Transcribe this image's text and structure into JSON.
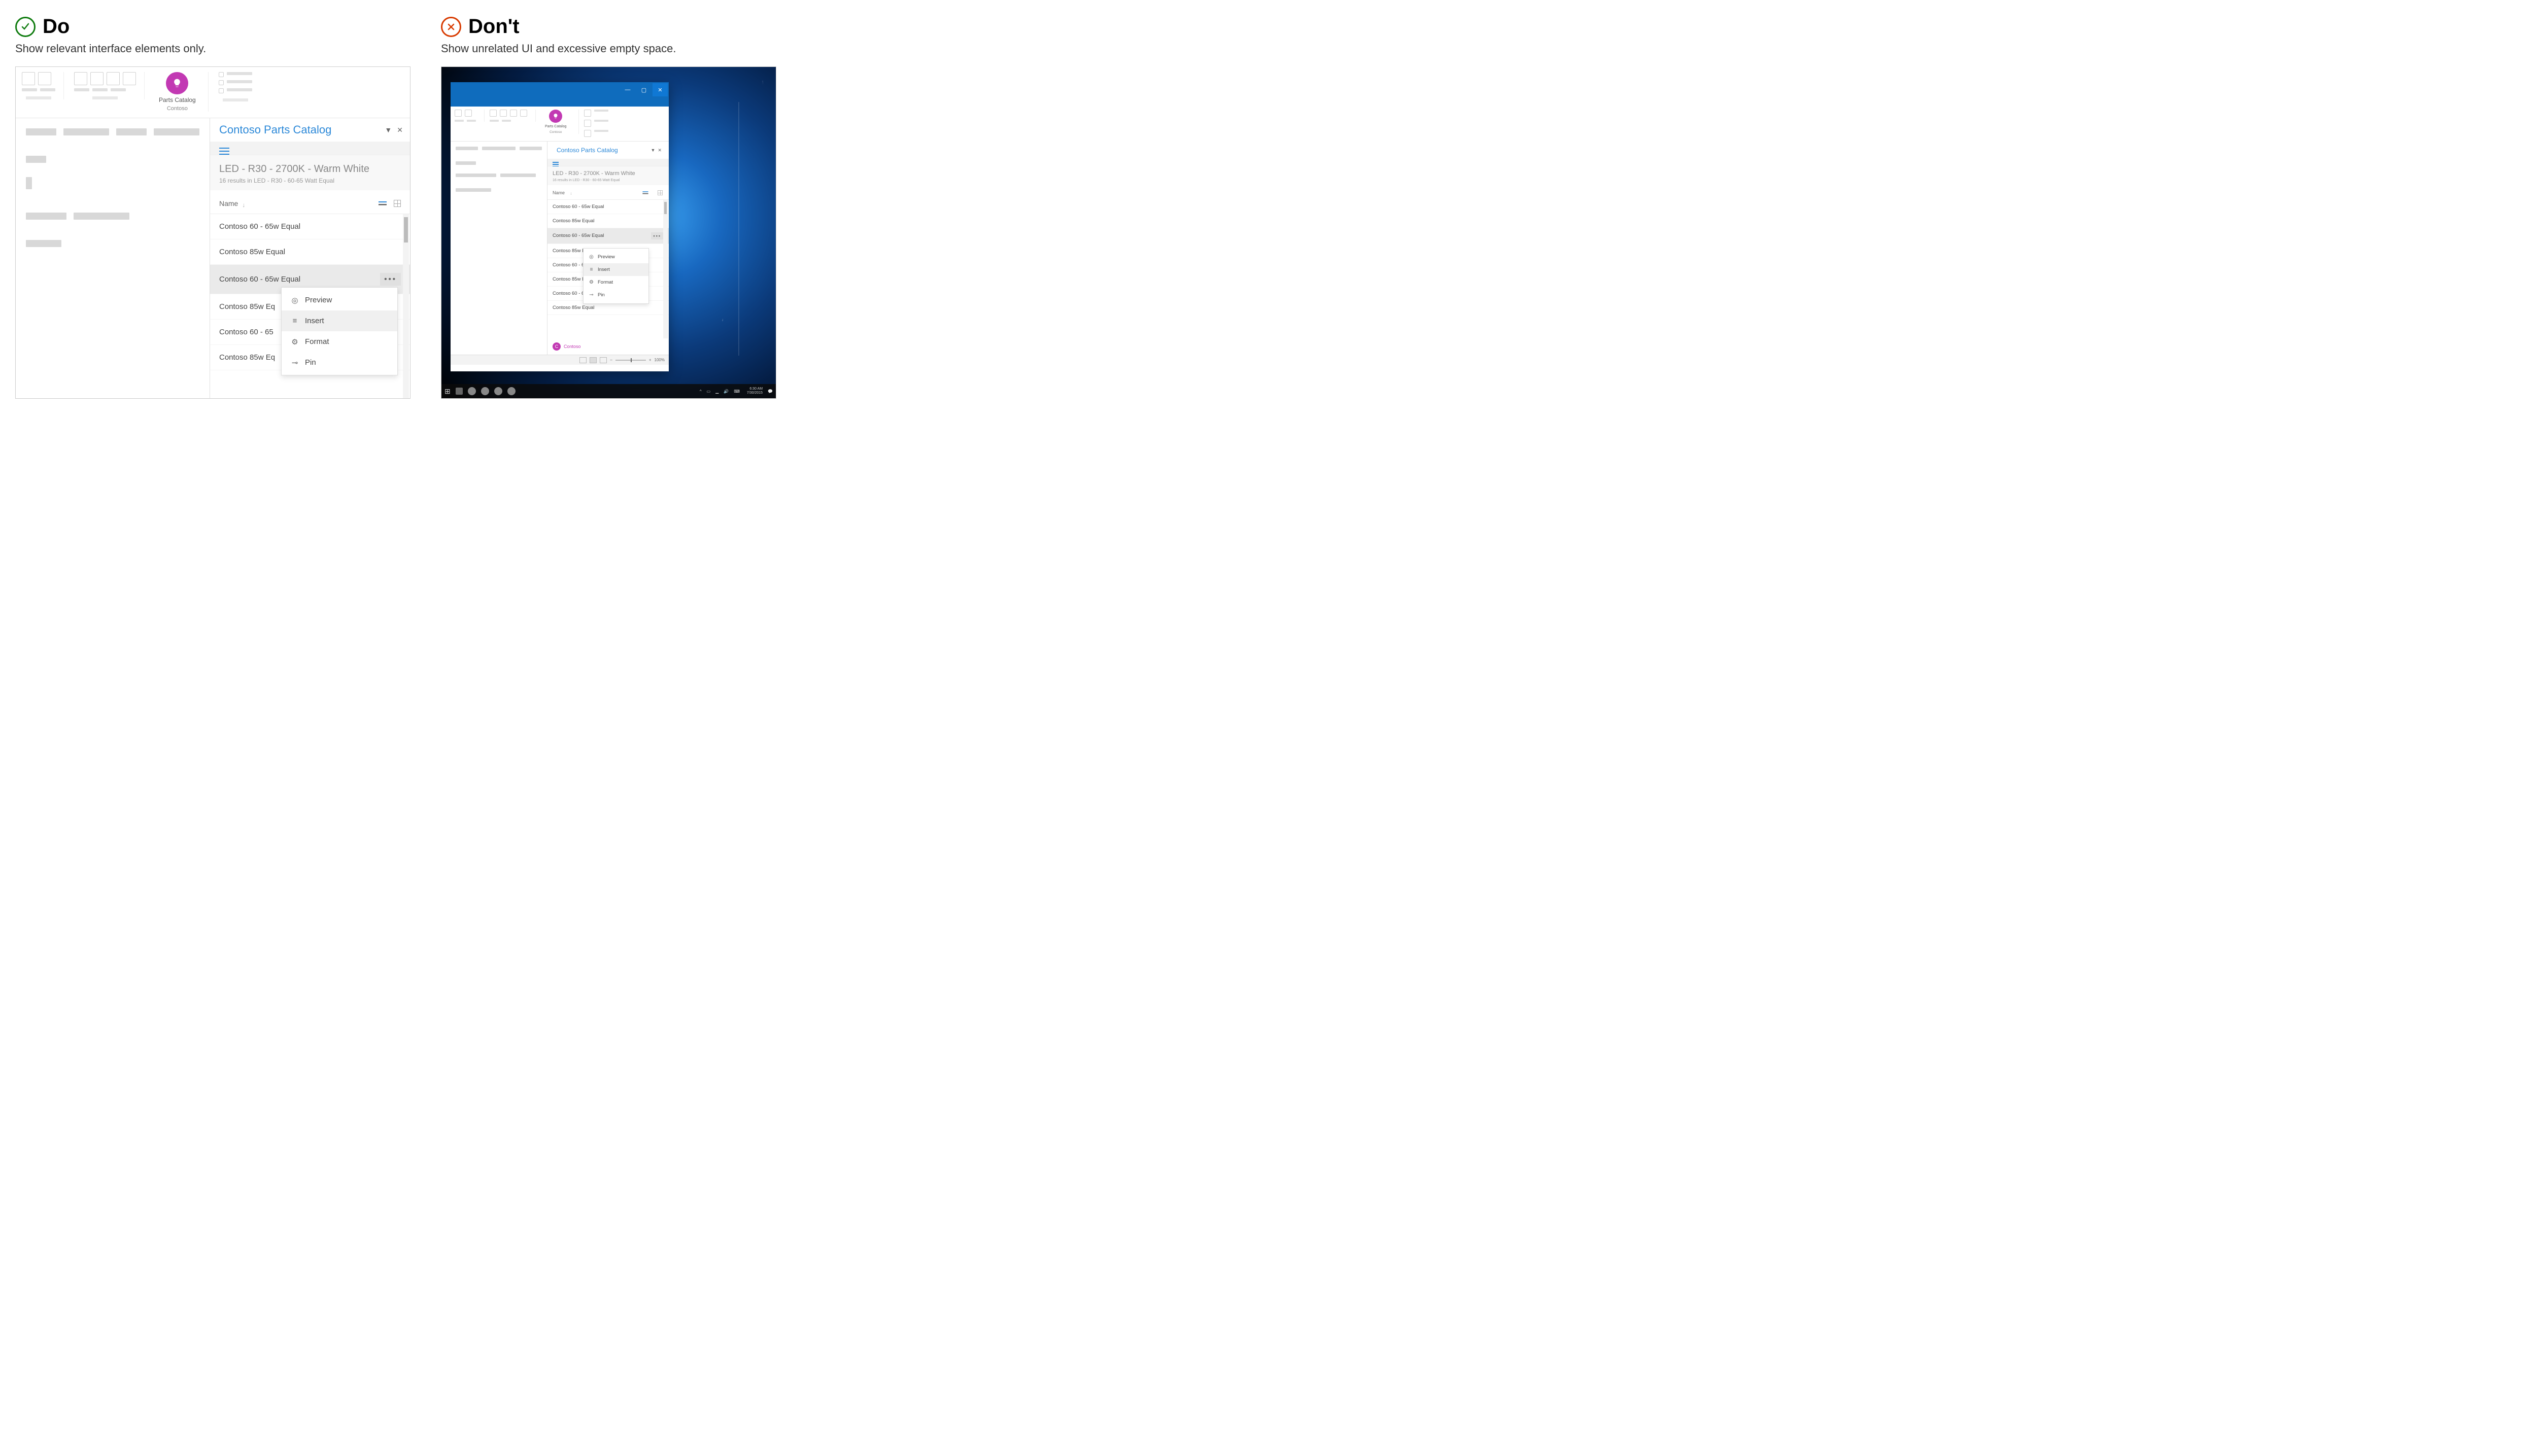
{
  "do": {
    "heading": "Do",
    "subtitle": "Show relevant interface elements only."
  },
  "dont": {
    "heading": "Don't",
    "subtitle": "Show unrelated UI and excessive empty space."
  },
  "ribbon": {
    "addin_line1": "Parts Catalog",
    "addin_line2": "Contoso"
  },
  "pane": {
    "title": "Contoso Parts Catalog",
    "breadcrumb_title": "LED - R30 - 2700K - Warm White",
    "breadcrumb_sub": "16 results in LED - R30 - 60-65 Watt Equal",
    "sort_label": "Name",
    "items": [
      "Contoso 60 - 65w Equal",
      "Contoso 85w Equal",
      "Contoso 60 - 65w Equal",
      "Contoso 85w Eq",
      "Contoso 60 - 65",
      "Contoso 85w Eq"
    ],
    "items_full": [
      "Contoso 60 - 65w Equal",
      "Contoso 85w Equal",
      "Contoso 60 - 65w Equal",
      "Contoso 85w Equal",
      "Contoso 60 - 65w Equal",
      "Contoso 85w Equal",
      "Contoso 60 - 65w Equal",
      "Contoso 85w Equal"
    ]
  },
  "menu": {
    "preview": "Preview",
    "insert": "Insert",
    "format": "Format",
    "pin": "Pin"
  },
  "brand": {
    "initial": "C",
    "name": "Contoso"
  },
  "status": {
    "zoom": "100%",
    "plus": "+"
  },
  "taskbar": {
    "time": "6:30 AM",
    "date": "7/30/2015"
  }
}
